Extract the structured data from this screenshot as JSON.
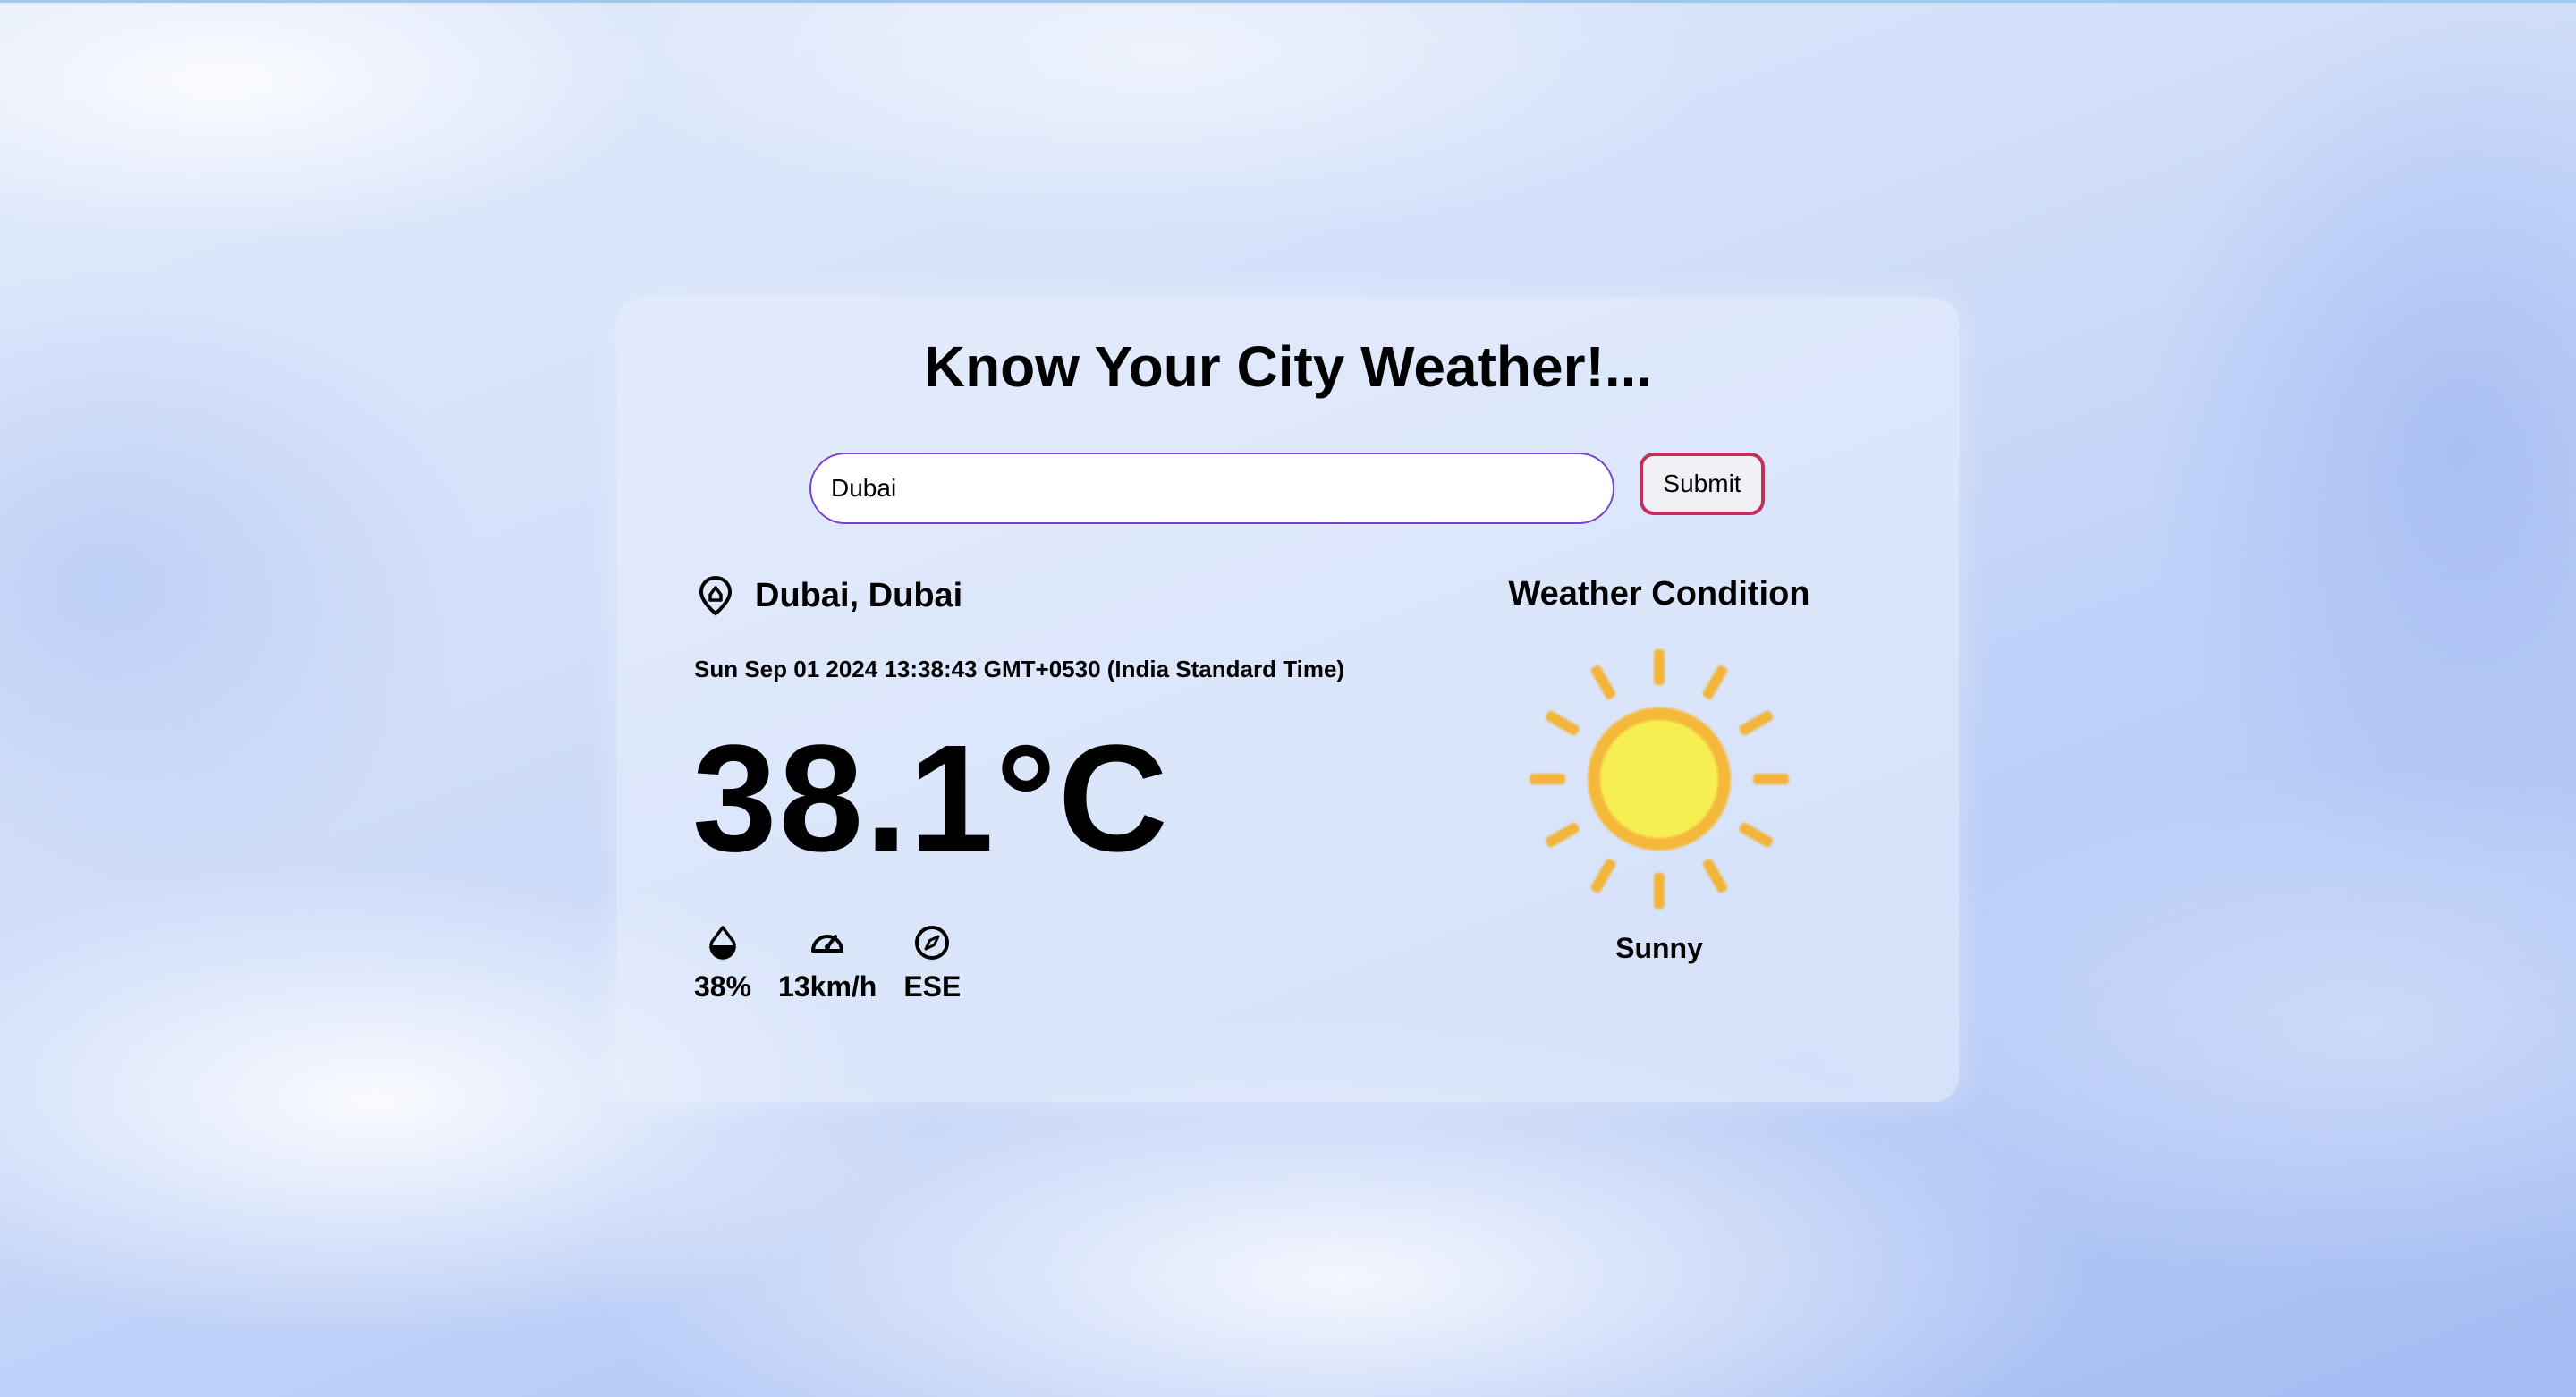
{
  "app": {
    "title": "Know Your City Weather!..."
  },
  "search": {
    "value": "Dubai",
    "submit_label": "Submit"
  },
  "location": {
    "text": "Dubai, Dubai",
    "icon": "location-pin-icon"
  },
  "datetime": "Sun Sep 01 2024 13:38:43 GMT+0530 (India Standard Time)",
  "temperature": "38.1°C",
  "stats": {
    "humidity": "38%",
    "wind_speed": "13km/h",
    "wind_direction": "ESE",
    "icons": [
      "humidity-drop-icon",
      "speedometer-icon",
      "compass-icon"
    ]
  },
  "condition": {
    "heading": "Weather Condition",
    "label": "Sunny",
    "icon": "sun-icon"
  },
  "colors": {
    "input_border": "#7a3fd1",
    "button_border": "#c0305c",
    "sun_core": "#f7ee52",
    "sun_rays": "#f2b43a"
  }
}
